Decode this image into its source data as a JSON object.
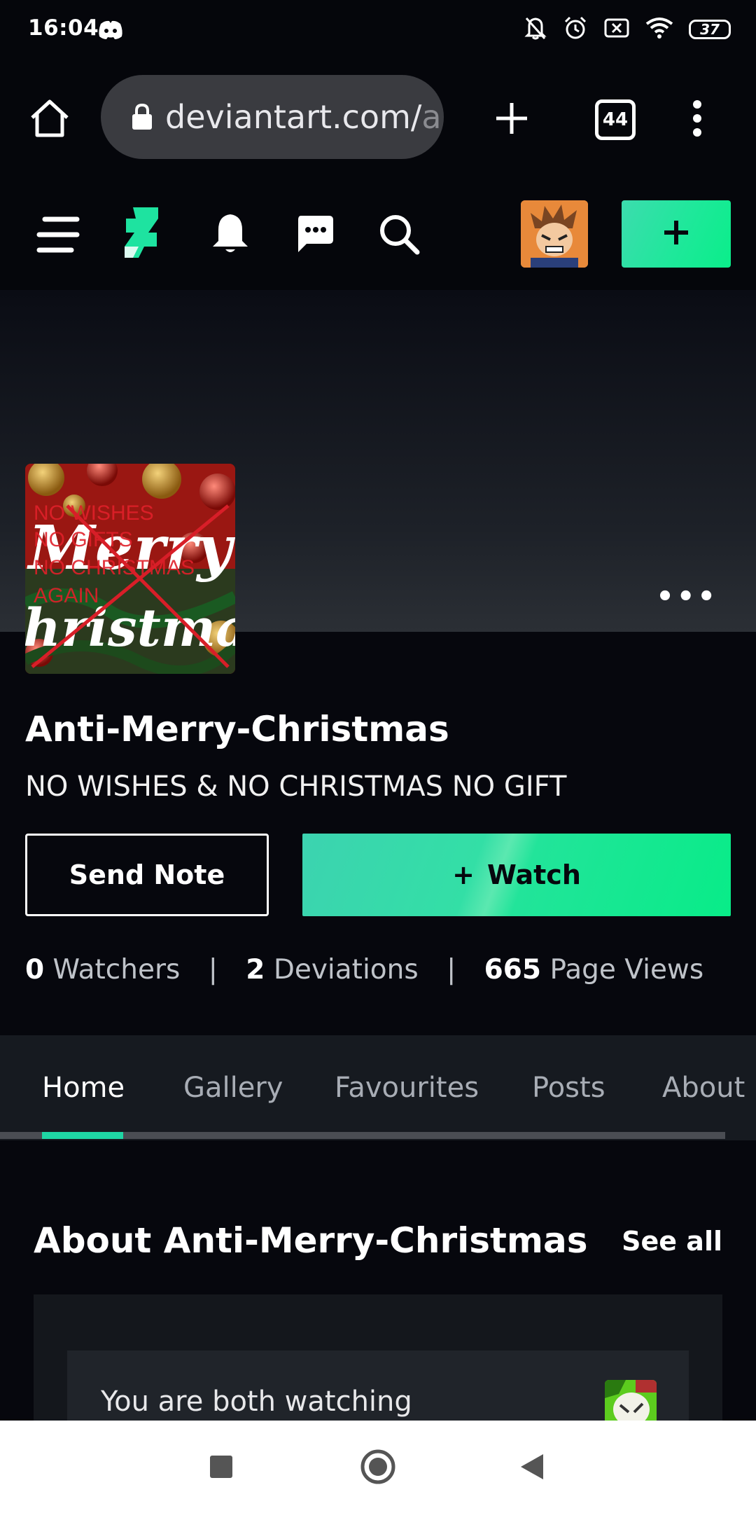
{
  "status_bar": {
    "time": "16:04",
    "battery": "37",
    "icons": [
      "discord-icon",
      "bell-off-icon",
      "alarm-icon",
      "sim-off-icon",
      "wifi-icon",
      "battery-icon"
    ]
  },
  "browser": {
    "url_main": "deviantart.com/",
    "url_faded": "a",
    "tab_count": "44",
    "icons": [
      "home-icon",
      "lock-icon",
      "new-tab-icon",
      "tabs-icon",
      "menu-icon"
    ]
  },
  "da_nav": {
    "icons": [
      "hamburger-icon",
      "deviantart-logo-icon",
      "bell-icon",
      "messages-icon",
      "search-icon",
      "user-avatar",
      "plus-icon"
    ],
    "submit_label": "+"
  },
  "banner": {
    "more_label": "•••"
  },
  "profile": {
    "avatar_text": [
      "NO WISHES",
      "NO GIFTS",
      "NO CHRISTMAS",
      "AGAIN",
      "Merry",
      "Christmas"
    ],
    "username": "Anti-Merry-Christmas",
    "tagline": "NO WISHES & NO CHRISTMAS NO GIFT",
    "send_note_label": "Send Note",
    "watch_plus": "+",
    "watch_label": "Watch"
  },
  "stats": {
    "watchers_count": "0",
    "watchers_label": "Watchers",
    "deviations_count": "2",
    "deviations_label": "Deviations",
    "views_count": "665",
    "views_label": "Page Views",
    "separator": "|"
  },
  "tabs": [
    {
      "label": "Home",
      "active": true
    },
    {
      "label": "Gallery",
      "active": false
    },
    {
      "label": "Favourites",
      "active": false
    },
    {
      "label": "Posts",
      "active": false
    },
    {
      "label": "About",
      "active": false
    }
  ],
  "about": {
    "title": "About Anti-Merry-Christmas",
    "see_all": "See all",
    "both_watching": "You are both watching"
  },
  "colors": {
    "accent": "#1fd6a4",
    "watch_start": "#3cd3b0",
    "watch_end": "#08ec88",
    "background": "#06070d"
  }
}
